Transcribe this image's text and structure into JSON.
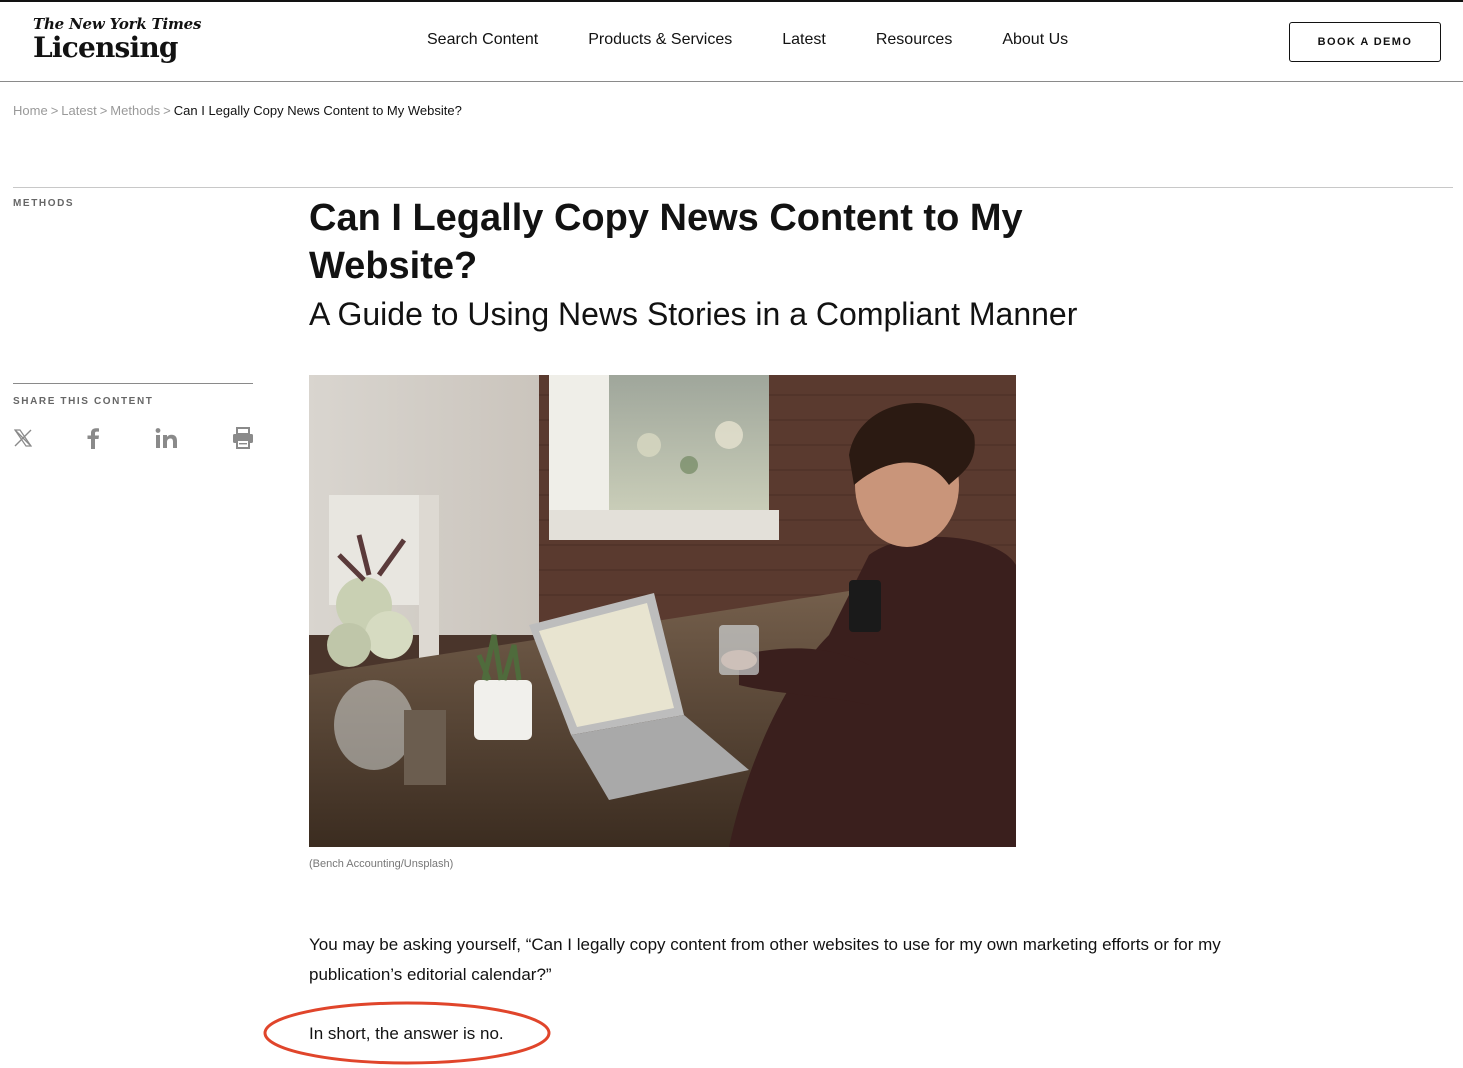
{
  "header": {
    "logo_top": "The New York Times",
    "logo_bottom": "Licensing",
    "nav": [
      {
        "label": "Search Content"
      },
      {
        "label": "Products & Services"
      },
      {
        "label": "Latest"
      },
      {
        "label": "Resources"
      },
      {
        "label": "About Us"
      }
    ],
    "cta_label": "BOOK A DEMO"
  },
  "breadcrumb": {
    "items": [
      "Home",
      "Latest",
      "Methods"
    ],
    "separator": ">",
    "current": "Can I Legally Copy News Content to My Website?"
  },
  "sidebar": {
    "category": "METHODS",
    "share_label": "SHARE THIS CONTENT",
    "share_icons": [
      "x-icon",
      "facebook-icon",
      "linkedin-icon",
      "print-icon"
    ]
  },
  "article": {
    "title": "Can I Legally Copy News Content to My Website?",
    "subtitle": "A Guide to Using News Stories in a Compliant Manner",
    "image_caption": "(Bench Accounting/Unsplash)",
    "paragraph_1": "You may be asking yourself, “Can I legally copy content from other websites to use for my own marketing efforts or for my publication’s editorial calendar?”",
    "paragraph_2": "In short, the answer is no."
  },
  "colors": {
    "annotation": "#e0452b",
    "text": "#121212",
    "muted": "#999999"
  }
}
